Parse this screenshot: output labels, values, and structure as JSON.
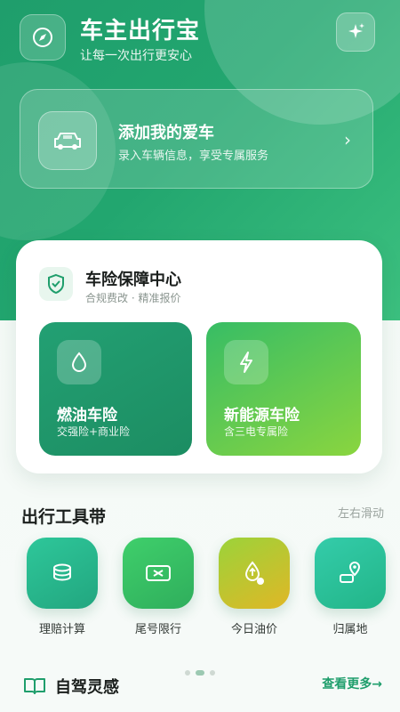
{
  "colors": {
    "brand": "#1f9e6c",
    "hero_start": "#1f9e6c",
    "hero_end": "#3cc07f",
    "fuel_tile": "#1c8d62",
    "ev_tile": "#8ad53f"
  },
  "header": {
    "logo_icon": "compass-icon",
    "title": "车主出行宝",
    "subtitle": "让每一次出行更安心",
    "sparkle_icon": "sparkle-icon"
  },
  "add_car": {
    "icon": "car-icon",
    "title": "添加我的爱车",
    "subtitle": "录入车辆信息，享受专属服务",
    "arrow_icon": "chevron-right-icon"
  },
  "insurance": {
    "icon": "shield-check-icon",
    "title": "车险保障中心",
    "subtitle": "合规费改 · 精准报价",
    "tiles": [
      {
        "icon": "drop-icon",
        "title": "燃油车险",
        "subtitle": "交强险+商业险"
      },
      {
        "icon": "lightning-icon",
        "title": "新能源车险",
        "subtitle": "含三电专属险"
      }
    ]
  },
  "tools": {
    "title": "出行工具带",
    "hint": "左右滑动",
    "items": [
      {
        "icon": "coin-stack-icon",
        "label": "理赔计算",
        "color": "#2bbf98"
      },
      {
        "icon": "license-plate-icon",
        "label": "尾号限行",
        "color": "#3cc46b"
      },
      {
        "icon": "fuel-price-icon",
        "label": "今日油价",
        "color": "#a9cf2e"
      },
      {
        "icon": "location-pin-icon",
        "label": "归属地",
        "color": "#2ec39a"
      }
    ]
  },
  "bottom": {
    "icon": "book-icon",
    "title": "自驾灵感",
    "more": "查看更多→"
  }
}
